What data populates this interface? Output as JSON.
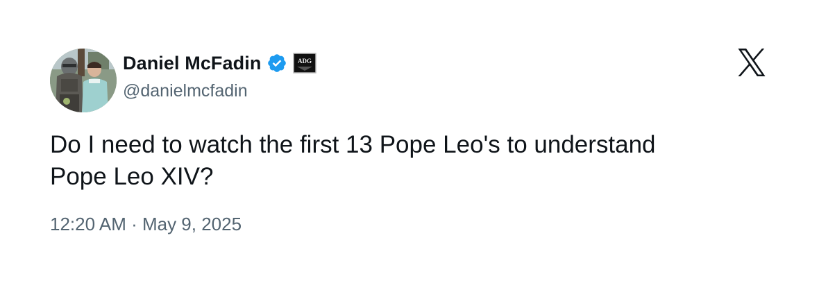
{
  "author": {
    "display_name": "Daniel McFadin",
    "handle": "@danielmcfadin",
    "verified": true,
    "affiliate_badge_text": "ADG",
    "avatar_icon": "profile-photo"
  },
  "tweet": {
    "text": "Do I need to watch the first 13 Pope Leo's to understand\nPope Leo XIV?",
    "timestamp": "12:20 AM · May 9, 2025"
  },
  "platform": {
    "logo_icon": "x-logo-icon"
  },
  "colors": {
    "verified_blue": "#1d9bf0",
    "text_primary": "#0f1419",
    "text_secondary": "#536471"
  }
}
